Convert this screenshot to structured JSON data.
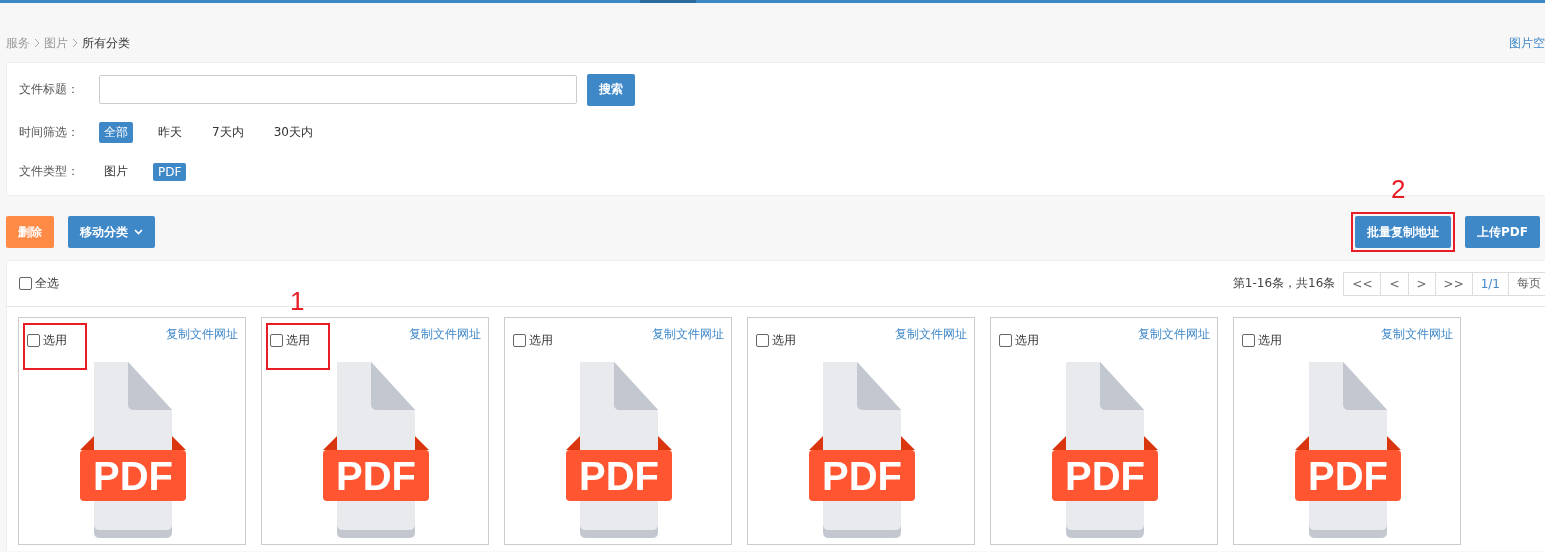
{
  "breadcrumb": [
    {
      "label": "服务",
      "current": false
    },
    {
      "label": "图片",
      "current": false
    },
    {
      "label": "所有分类",
      "current": true
    }
  ],
  "header_link": "图片空",
  "filters": {
    "title_label": "文件标题：",
    "search_button": "搜索",
    "time_label": "时间筛选：",
    "time_options": [
      {
        "label": "全部",
        "selected": true
      },
      {
        "label": "昨天",
        "selected": false
      },
      {
        "label": "7天内",
        "selected": false
      },
      {
        "label": "30天内",
        "selected": false
      }
    ],
    "type_label": "文件类型：",
    "type_options": [
      {
        "label": "图片",
        "selected": false
      },
      {
        "label": "PDF",
        "selected": true
      }
    ]
  },
  "toolbar": {
    "left": [
      {
        "label": "删除",
        "kind": "danger",
        "dropdown": false
      },
      {
        "label": "移动分类",
        "kind": "primary",
        "dropdown": true
      }
    ],
    "right": [
      {
        "label": "批量复制地址",
        "kind": "primary",
        "highlighted": true,
        "marker": "2"
      },
      {
        "label": "上传PDF",
        "kind": "primary",
        "highlighted": false
      }
    ]
  },
  "select_all": {
    "label": "全选",
    "checked": false
  },
  "pagination": {
    "summary": "第1-16条，共16条",
    "buttons": [
      "<<",
      "<",
      ">",
      ">>"
    ],
    "page": "1/1",
    "per_page": "每页"
  },
  "cards": [
    {
      "select_label": "选用",
      "checked": false,
      "link": "复制文件网址",
      "file_type": "PDF",
      "highlighted": true
    },
    {
      "select_label": "选用",
      "checked": false,
      "link": "复制文件网址",
      "file_type": "PDF",
      "highlighted": true,
      "marker": "1"
    },
    {
      "select_label": "选用",
      "checked": false,
      "link": "复制文件网址",
      "file_type": "PDF",
      "highlighted": false
    },
    {
      "select_label": "选用",
      "checked": false,
      "link": "复制文件网址",
      "file_type": "PDF",
      "highlighted": false
    },
    {
      "select_label": "选用",
      "checked": false,
      "link": "复制文件网址",
      "file_type": "PDF",
      "highlighted": false
    },
    {
      "select_label": "选用",
      "checked": false,
      "link": "复制文件网址",
      "file_type": "PDF",
      "highlighted": false
    }
  ]
}
